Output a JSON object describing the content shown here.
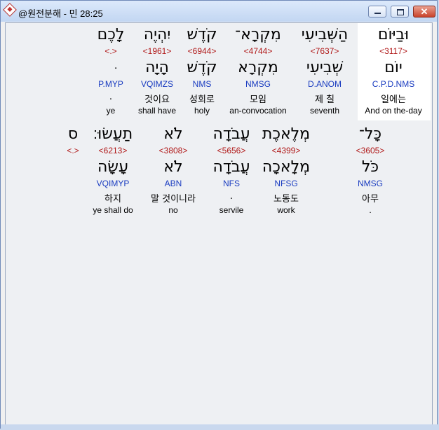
{
  "window": {
    "title": "@원전분해 - 민 28:25"
  },
  "controls": {
    "minimize": "─",
    "maximize": "□",
    "close": "✕"
  },
  "rows": [
    {
      "words": [
        {
          "hebrew": "וּבַיּוֹם",
          "strong": "<3117>",
          "lemma": "יוֹם",
          "morph": "C.P.D.NMS",
          "korean": "일에는",
          "english": "And on the-day"
        },
        {
          "hebrew": "הַשְּׁבִיעִי",
          "strong": "<7637>",
          "lemma": "שְׁבִיעִי",
          "morph": "D.ANOM",
          "korean": "제 칠",
          "english": "seventh"
        },
        {
          "hebrew": "מִקְרָא־",
          "strong": "<4744>",
          "lemma": "מִקְרָא",
          "morph": "NMSG",
          "korean": "모임",
          "english": "an-convocation"
        },
        {
          "hebrew": "קֹדֶשׁ",
          "strong": "<6944>",
          "lemma": "קֹדֶשׁ",
          "morph": "NMS",
          "korean": "성회로",
          "english": "holy"
        },
        {
          "hebrew": "יִהְיֶה",
          "strong": "<1961>",
          "lemma": "הָיָה",
          "morph": "VQIMZS",
          "korean": "것이요",
          "english": "shall have"
        },
        {
          "hebrew": "לָכֶם",
          "strong": "<.>",
          "lemma": "ּ",
          "morph": "P.MYP",
          "korean": ".",
          "english": "ye"
        }
      ]
    },
    {
      "words": [
        {
          "hebrew": "כָּל־",
          "strong": "<3605>",
          "lemma": "כֹּל",
          "morph": "NMSG",
          "korean": "아무",
          "english": "."
        },
        {
          "hebrew": "מְלֶאכֶת",
          "strong": "<4399>",
          "lemma": "מְלָאכָה",
          "morph": "NFSG",
          "korean": "노동도",
          "english": "work"
        },
        {
          "hebrew": "עֲבֹדָה",
          "strong": "<5656>",
          "lemma": "עֲבֹדָה",
          "morph": "NFS",
          "korean": ".",
          "english": "servile"
        },
        {
          "hebrew": "לֹא",
          "strong": "<3808>",
          "lemma": "לֹא",
          "morph": "ABN",
          "korean": "말 것이니라",
          "english": "no"
        },
        {
          "hebrew": "תַעֲשׂוּ׃",
          "strong": "<6213>",
          "lemma": "עָשָׂה",
          "morph": "VQIMYP",
          "korean": "하지",
          "english": "ye shall do"
        },
        {
          "hebrew": "ס",
          "strong": "<.>",
          "lemma": "",
          "morph": "",
          "korean": "",
          "english": ""
        }
      ]
    }
  ]
}
